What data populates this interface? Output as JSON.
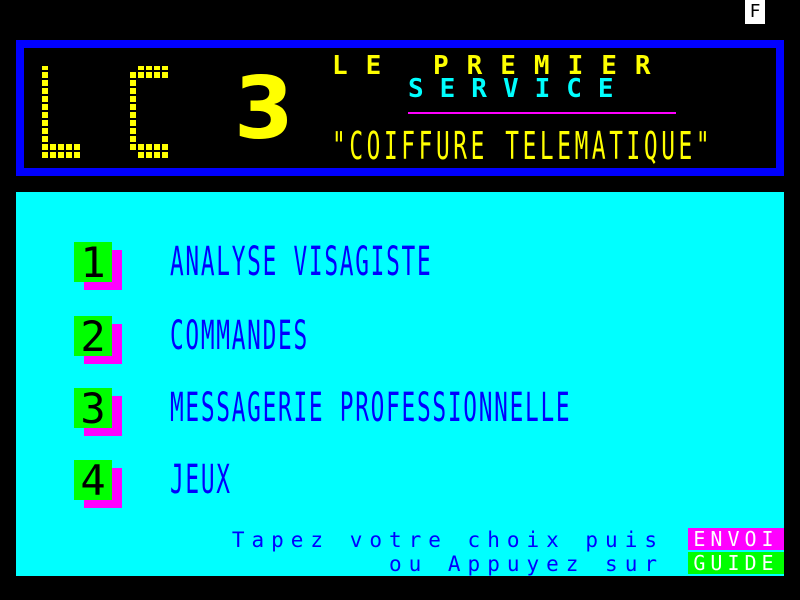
{
  "status": {
    "indicator": "F"
  },
  "header": {
    "logo_text": "LC",
    "logo_exponent": "3",
    "tagline_line1": "LE PREMIER",
    "tagline_line2": "SERVICE",
    "tagline_line3": "\"COIFFURE TELEMATIQUE\""
  },
  "menu": {
    "items": [
      {
        "number": "1",
        "label": "ANALYSE VISAGISTE"
      },
      {
        "number": "2",
        "label": "COMMANDES"
      },
      {
        "number": "3",
        "label": "MESSAGERIE PROFESSIONNELLE"
      },
      {
        "number": "4",
        "label": "JEUX"
      }
    ]
  },
  "prompt": {
    "line1": "Tapez votre choix puis",
    "line2": "ou Appuyez sur",
    "envoi_key": "ENVOI",
    "guide_key": "GUIDE"
  },
  "colors": {
    "background": "#000000",
    "panel": "#00ffff",
    "text_blue": "#0000ff",
    "accent_yellow": "#ffff00",
    "accent_green": "#00ff00",
    "accent_magenta": "#ff00ff",
    "border_blue": "#0000ff"
  }
}
